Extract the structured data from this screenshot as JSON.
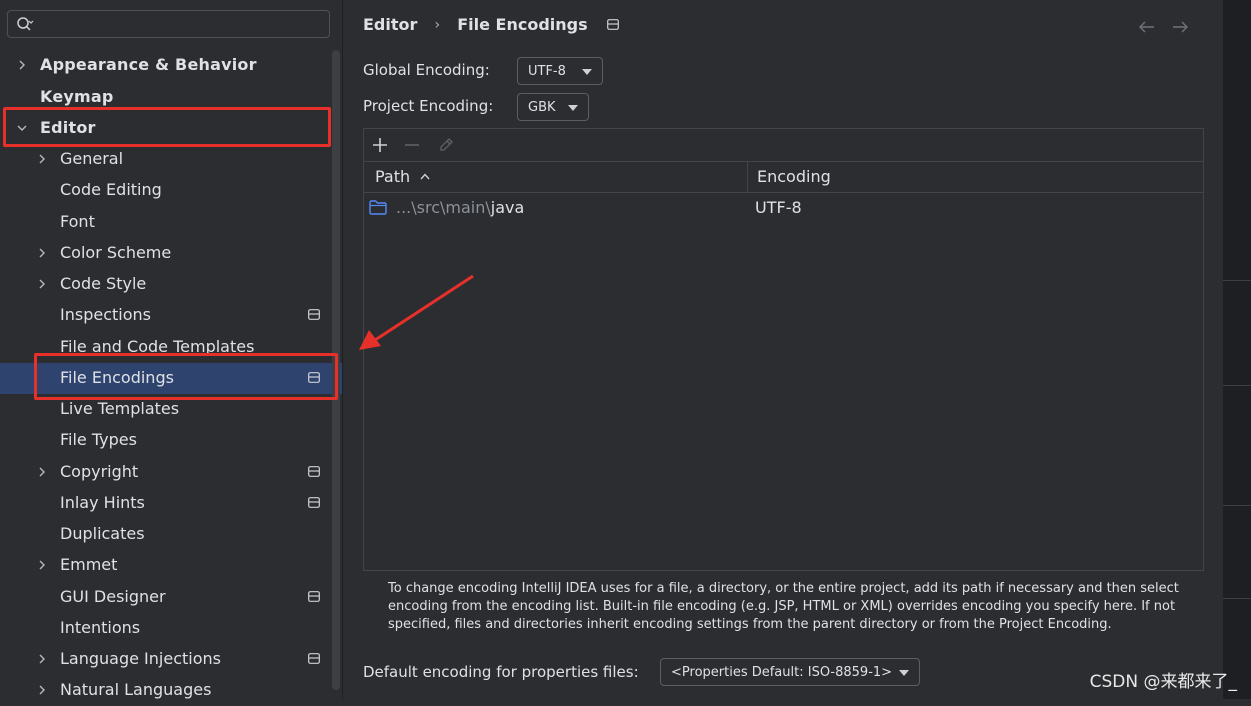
{
  "search": {
    "placeholder": "",
    "value": ""
  },
  "tree": {
    "appearance": "Appearance & Behavior",
    "keymap": "Keymap",
    "editor": "Editor",
    "general": "General",
    "code_editing": "Code Editing",
    "font": "Font",
    "color_scheme": "Color Scheme",
    "code_style": "Code Style",
    "inspections": "Inspections",
    "file_code_templates": "File and Code Templates",
    "file_encodings": "File Encodings",
    "live_templates": "Live Templates",
    "file_types": "File Types",
    "copyright": "Copyright",
    "inlay_hints": "Inlay Hints",
    "duplicates": "Duplicates",
    "emmet": "Emmet",
    "gui_designer": "GUI Designer",
    "intentions": "Intentions",
    "language_injections": "Language Injections",
    "natural_languages": "Natural Languages"
  },
  "breadcrumb": {
    "parent": "Editor",
    "current": "File Encodings"
  },
  "form": {
    "global_label": "Global Encoding:",
    "global_value": "UTF-8",
    "project_label": "Project Encoding:",
    "project_value": "GBK",
    "default_label": "Default encoding for properties files:",
    "default_value": "<Properties Default: ISO-8859-1>"
  },
  "table": {
    "col_path": "Path",
    "col_encoding": "Encoding",
    "rows": [
      {
        "path_dim_1": "...\\src\\main\\",
        "path_bright": "java",
        "encoding": "UTF-8"
      }
    ]
  },
  "help_text": "To change encoding IntelliJ IDEA uses for a file, a directory, or the entire project, add its path if necessary and then select encoding from the encoding list. Built-in file encoding (e.g. JSP, HTML or XML) overrides encoding you specify here. If not specified, files and directories inherit encoding settings from the parent directory or from the Project Encoding.",
  "watermark": "CSDN @来都来了_",
  "colors": {
    "background": "#2b2d30",
    "selection": "#2e436e",
    "highlight": "#e8302a",
    "folder": "#548af7"
  }
}
